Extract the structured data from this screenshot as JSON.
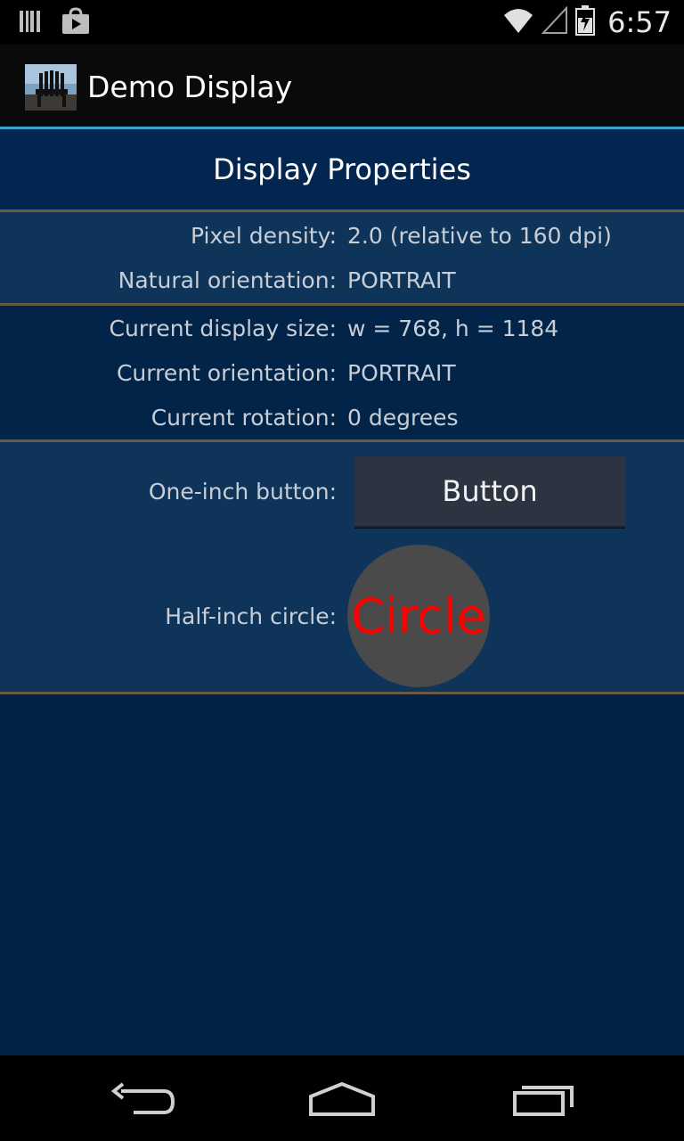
{
  "status_bar": {
    "time": "6:57",
    "icons": [
      "barcode-icon",
      "shopping-bag-icon",
      "wifi-icon",
      "signal-icon",
      "battery-charging-icon"
    ]
  },
  "action_bar": {
    "title": "Demo Display",
    "icon": "app-chair-icon"
  },
  "header": {
    "title": "Display Properties"
  },
  "section1": {
    "rows": [
      {
        "label": "Pixel density:",
        "value": "2.0 (relative to 160 dpi)"
      },
      {
        "label": "Natural orientation:",
        "value": "PORTRAIT"
      }
    ]
  },
  "section2": {
    "rows": [
      {
        "label": "Current display size:",
        "value": "w = 768, h = 1184"
      },
      {
        "label": "Current orientation:",
        "value": "PORTRAIT"
      },
      {
        "label": "Current rotation:",
        "value": "0 degrees"
      }
    ]
  },
  "section3": {
    "button_label_text": "One-inch button:",
    "button_text": "Button",
    "circle_label_text": "Half-inch circle:",
    "circle_text": "Circle"
  },
  "nav_bar": {
    "icons": [
      "back-icon",
      "home-icon",
      "recent-apps-icon"
    ]
  },
  "colors": {
    "accent": "#36a5d9",
    "background": "#012146",
    "circle_text": "#ff0000"
  }
}
